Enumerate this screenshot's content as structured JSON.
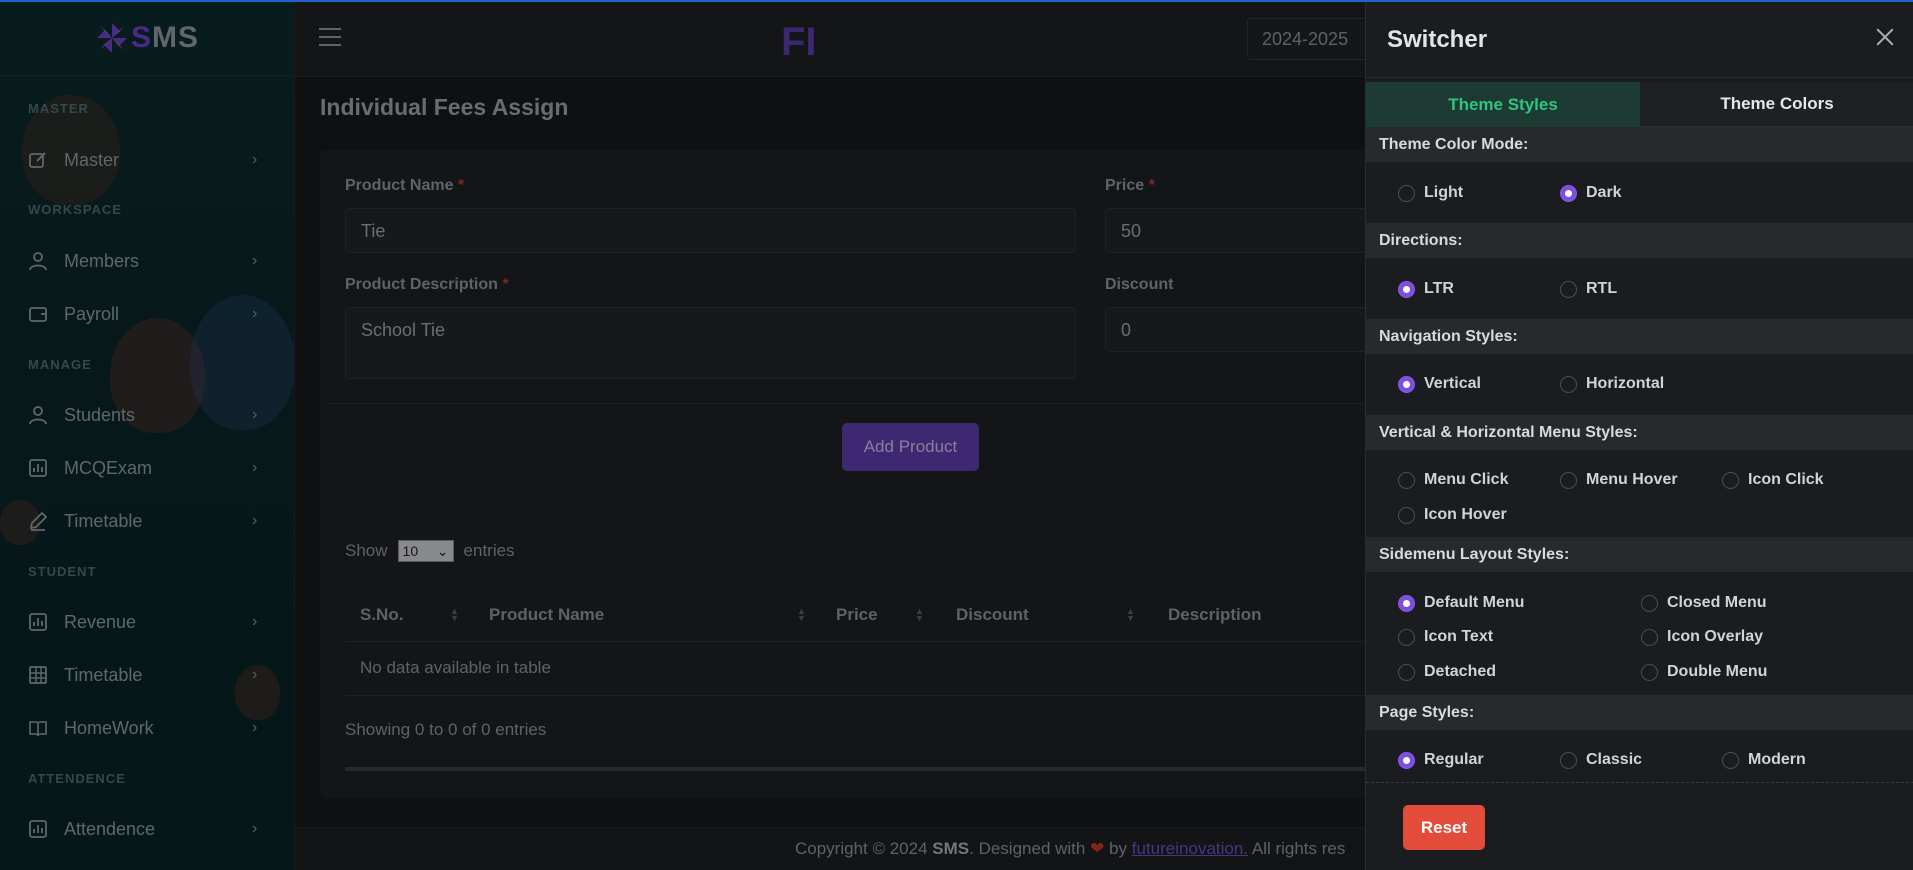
{
  "brand": {
    "logo_text": "SMS",
    "header_logo": "FI"
  },
  "sidebar": {
    "sections": [
      {
        "label": "MASTER",
        "items": [
          {
            "label": "Master",
            "icon": "edit-icon"
          }
        ]
      },
      {
        "label": "WORKSPACE",
        "items": [
          {
            "label": "Members",
            "icon": "user-icon"
          },
          {
            "label": "Payroll",
            "icon": "wallet-icon"
          }
        ]
      },
      {
        "label": "MANAGE",
        "items": [
          {
            "label": "Students",
            "icon": "user-icon"
          },
          {
            "label": "MCQExam",
            "icon": "chart-icon"
          },
          {
            "label": "Timetable",
            "icon": "pencil-icon"
          }
        ]
      },
      {
        "label": "STUDENT",
        "items": [
          {
            "label": "Revenue",
            "icon": "chart-icon"
          },
          {
            "label": "Timetable",
            "icon": "grid-icon"
          },
          {
            "label": "HomeWork",
            "icon": "book-icon"
          }
        ]
      },
      {
        "label": "ATTENDENCE",
        "items": [
          {
            "label": "Attendence",
            "icon": "chart-icon"
          }
        ]
      }
    ]
  },
  "header": {
    "year": "2024-2025"
  },
  "page": {
    "title": "Individual Fees Assign",
    "form": {
      "product_name_label": "Product Name",
      "product_name_value": "Tie",
      "price_label": "Price",
      "price_value": "50",
      "description_label": "Product Description",
      "description_value": "School Tie",
      "discount_label": "Discount",
      "discount_value": "0",
      "required_mark": "*",
      "submit_label": "Add Product"
    },
    "table": {
      "show_label": "Show",
      "entries_label": "entries",
      "page_size": "10",
      "columns": [
        "S.No.",
        "Product Name",
        "Price",
        "Discount",
        "Description"
      ],
      "empty_text": "No data available in table",
      "info": "Showing 0 to 0 of 0 entries"
    }
  },
  "footer": {
    "prefix": "Copyright © 2024",
    "brand": "SMS",
    "designed": ". Designed with",
    "heart": "❤",
    "by": "by",
    "link": "futureinovation.",
    "suffix": "All rights res"
  },
  "switcher": {
    "title": "Switcher",
    "tabs": [
      "Theme Styles",
      "Theme Colors"
    ],
    "sections": {
      "color_mode": {
        "title": "Theme Color Mode:",
        "options": [
          "Light",
          "Dark"
        ],
        "selected": "Dark"
      },
      "directions": {
        "title": "Directions:",
        "options": [
          "LTR",
          "RTL"
        ],
        "selected": "LTR"
      },
      "navigation": {
        "title": "Navigation Styles:",
        "options": [
          "Vertical",
          "Horizontal"
        ],
        "selected": "Vertical"
      },
      "menu_styles": {
        "title": "Vertical & Horizontal Menu Styles:",
        "options": [
          "Menu Click",
          "Menu Hover",
          "Icon Click",
          "Icon Hover"
        ],
        "selected": ""
      },
      "sidemenu": {
        "title": "Sidemenu Layout Styles:",
        "options": [
          "Default Menu",
          "Closed Menu",
          "Icon Text",
          "Icon Overlay",
          "Detached",
          "Double Menu"
        ],
        "selected": "Default Menu"
      },
      "page_styles": {
        "title": "Page Styles:",
        "options": [
          "Regular",
          "Classic",
          "Modern"
        ],
        "selected": "Regular"
      }
    },
    "reset_label": "Reset"
  },
  "colors": {
    "accent": "#7c4fe0",
    "tab_active": "#2ec67e",
    "reset": "#e34b3a",
    "primary_button": "#5e3ca8"
  }
}
